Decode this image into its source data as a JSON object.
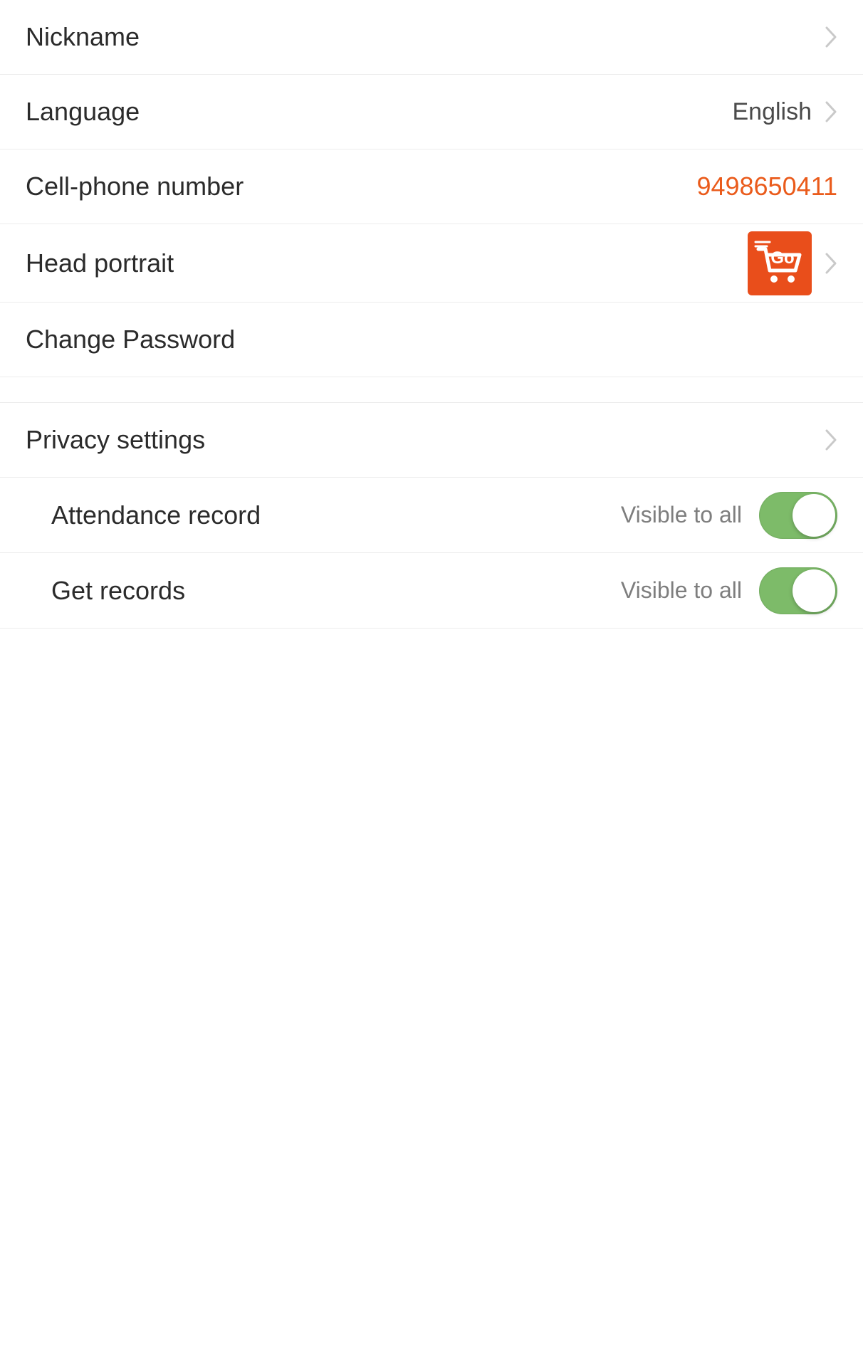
{
  "settings": {
    "nickname": {
      "label": "Nickname"
    },
    "language": {
      "label": "Language",
      "value": "English"
    },
    "phone": {
      "label": "Cell-phone number",
      "value": "9498650411"
    },
    "portrait": {
      "label": "Head portrait"
    },
    "password": {
      "label": "Change Password"
    }
  },
  "privacy": {
    "label": "Privacy settings",
    "attendance": {
      "label": "Attendance record",
      "status": "Visible to all",
      "on": true
    },
    "records": {
      "label": "Get records",
      "status": "Visible to all",
      "on": true
    }
  },
  "icons": {
    "avatar_alt": "Go"
  }
}
